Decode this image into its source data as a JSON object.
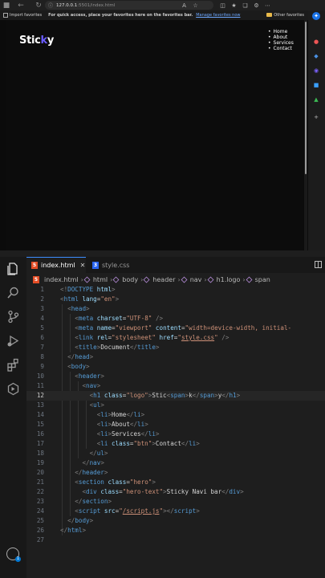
{
  "browser": {
    "address": {
      "host": "127.0.0.1",
      "path": ":5501/index.html"
    },
    "favorites_bar": {
      "import": "Import favorites",
      "hint": "For quick access, place your favorites here on the favorites bar.",
      "manage_link": "Manage favorites now",
      "other": "Other favorites"
    },
    "site": {
      "logo_part1": "Stic",
      "logo_accent": "k",
      "logo_part2": "y",
      "nav": [
        "Home",
        "About",
        "Services",
        "Contact"
      ]
    }
  },
  "editor": {
    "tabs": {
      "active": "index.html",
      "inactive": "style.css"
    },
    "breadcrumb": [
      "index.html",
      "html",
      "body",
      "header",
      "nav",
      "h1.logo",
      "span"
    ],
    "current_line": 12
  },
  "colors": {
    "accent": "#6a5cff",
    "tab_border": "#3c8dff"
  }
}
